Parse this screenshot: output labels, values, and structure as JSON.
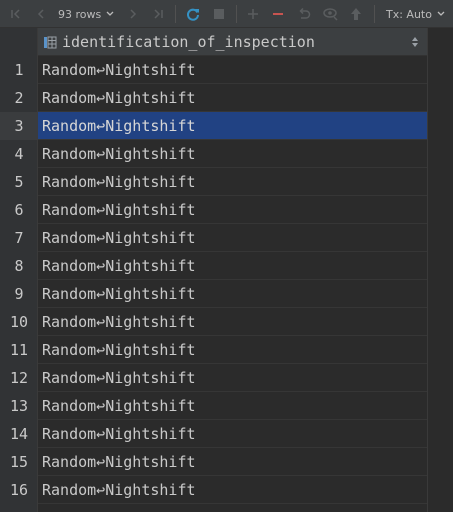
{
  "toolbar": {
    "rows_label": "93 rows",
    "tx_label": "Tx: Auto",
    "icons": [
      "first-page-icon",
      "prev-page-icon",
      "rows-dropdown-icon",
      "next-page-icon",
      "last-page-icon",
      "refresh-icon",
      "stop-icon",
      "add-row-icon",
      "delete-row-icon",
      "revert-icon",
      "preview-changes-icon",
      "submit-icon",
      "tx-dropdown-icon"
    ],
    "colors": {
      "refresh": "#3592c4",
      "delete": "#c75450",
      "disabled": "#5a5d5f"
    }
  },
  "grid": {
    "column_header": "identification_of_inspection",
    "rows": [
      {
        "num": "1",
        "value": "Random↩Nightshift"
      },
      {
        "num": "2",
        "value": "Random↩Nightshift"
      },
      {
        "num": "3",
        "value": "Random↩Nightshift"
      },
      {
        "num": "4",
        "value": "Random↩Nightshift"
      },
      {
        "num": "5",
        "value": "Random↩Nightshift"
      },
      {
        "num": "6",
        "value": "Random↩Nightshift"
      },
      {
        "num": "7",
        "value": "Random↩Nightshift"
      },
      {
        "num": "8",
        "value": "Random↩Nightshift"
      },
      {
        "num": "9",
        "value": "Random↩Nightshift"
      },
      {
        "num": "10",
        "value": "Random↩Nightshift"
      },
      {
        "num": "11",
        "value": "Random↩Nightshift"
      },
      {
        "num": "12",
        "value": "Random↩Nightshift"
      },
      {
        "num": "13",
        "value": "Random↩Nightshift"
      },
      {
        "num": "14",
        "value": "Random↩Nightshift"
      },
      {
        "num": "15",
        "value": "Random↩Nightshift"
      },
      {
        "num": "16",
        "value": "Random↩Nightshift"
      }
    ],
    "selected_row_index": 2,
    "selection_color": "#214283"
  }
}
